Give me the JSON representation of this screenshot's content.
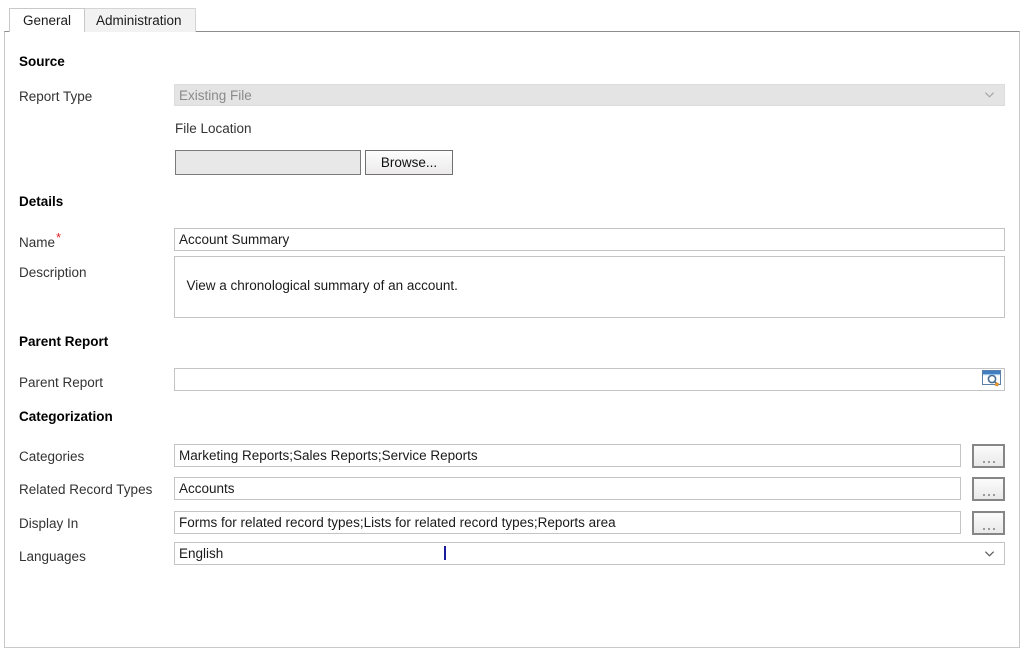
{
  "tabs": [
    {
      "label": "General",
      "selected": true
    },
    {
      "label": "Administration",
      "selected": false
    }
  ],
  "sections": {
    "source": {
      "heading": "Source",
      "report_type": {
        "label": "Report Type",
        "value": "Existing File",
        "disabled": true,
        "icon": "chevron-down-icon"
      },
      "file_location": {
        "label": "File Location",
        "value": "",
        "disabled": true
      },
      "browse_button": {
        "label": "Browse..."
      }
    },
    "details": {
      "heading": "Details",
      "name": {
        "label": "Name",
        "required_marker": "*",
        "value": "Account Summary"
      },
      "description": {
        "label": "Description",
        "value": "View a chronological summary of an account."
      }
    },
    "parent_report": {
      "heading": "Parent Report",
      "field": {
        "label": "Parent Report",
        "value": "",
        "lookup_icon": "lookup-magnifier-icon"
      }
    },
    "categorization": {
      "heading": "Categorization",
      "rows": [
        {
          "label": "Categories",
          "value": "Marketing Reports;Sales Reports;Service Reports",
          "button": "...",
          "kind": "text"
        },
        {
          "label": "Related Record Types",
          "value": "Accounts",
          "button": "...",
          "kind": "text"
        },
        {
          "label": "Display In",
          "value": "Forms for related record types;Lists for related record types;Reports area",
          "button": "...",
          "kind": "text"
        },
        {
          "label": "Languages",
          "value": "English",
          "kind": "combo",
          "icon": "chevron-down-icon"
        }
      ]
    }
  },
  "colors": {
    "required": "#e02020",
    "caret": "#1b1b9e",
    "border": "#c4c4c4",
    "disabled_bg": "#e4e4e4"
  }
}
